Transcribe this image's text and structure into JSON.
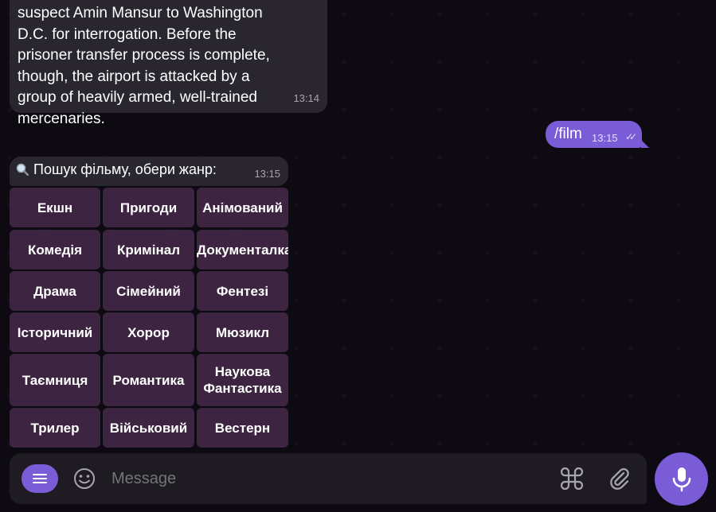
{
  "messages": {
    "incoming_text": "suspect Amin Mansur to Washington D.C. for interrogation. Before the prisoner transfer process is complete, though, the airport is attacked by a group of heavily armed, well-trained mercenaries.",
    "incoming_time": "13:14",
    "outgoing_command": "/film",
    "outgoing_time": "13:15",
    "bot_prompt": "Пошук фільму, обери жанр:",
    "bot_prompt_time": "13:15"
  },
  "keyboard": {
    "rows": [
      [
        "Екшн",
        "Пригоди",
        "Анімований"
      ],
      [
        "Комедія",
        "Кримінал",
        "Документалка"
      ],
      [
        "Драма",
        "Сімейний",
        "Фентезі"
      ],
      [
        "Історичний",
        "Хорор",
        "Мюзикл"
      ],
      [
        "Таємниця",
        "Романтика",
        "Наукова Фантастика"
      ],
      [
        "Трилер",
        "Військовий",
        "Вестерн"
      ]
    ]
  },
  "input": {
    "placeholder": "Message"
  },
  "icons": {
    "menu": "menu-icon",
    "emoji": "emoji-icon",
    "commands": "command-icon",
    "attach": "paperclip-icon",
    "mic": "microphone-icon",
    "read_receipt": "double-check-icon",
    "search": "magnifier-icon"
  },
  "colors": {
    "accent": "#7a5cd6",
    "keyboard_button": "#3d2441",
    "incoming_bubble": "#2a2630",
    "background": "#0d0a12"
  }
}
